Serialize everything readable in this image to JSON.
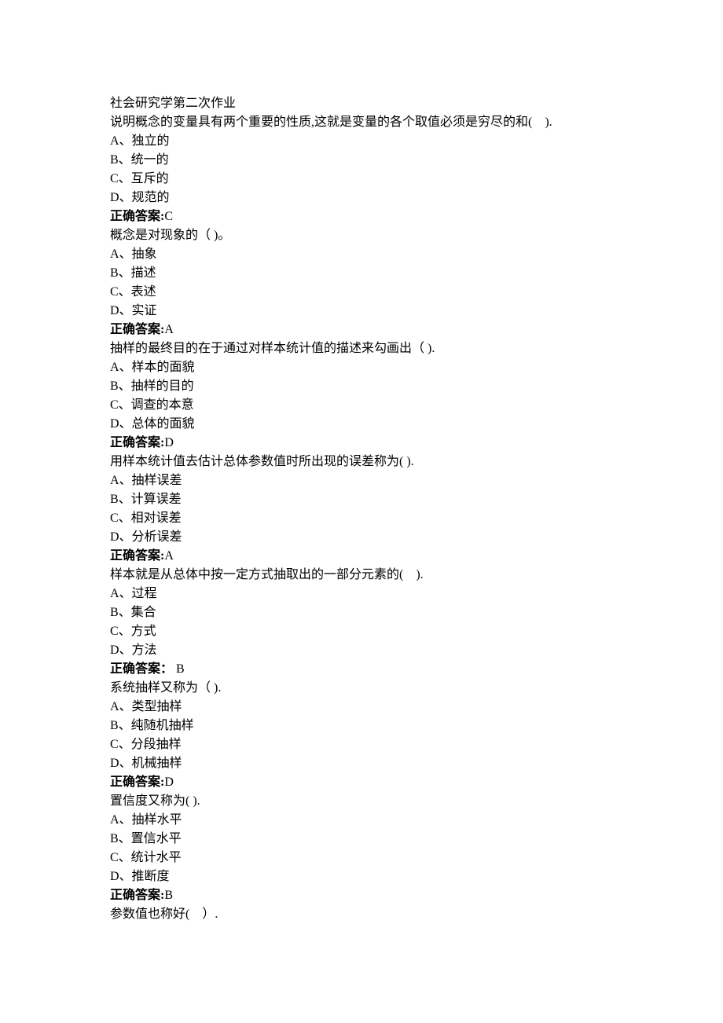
{
  "title": "社会研究学第二次作业",
  "answer_label": "正确答案",
  "answer_label_alt": "正确答案：",
  "questions": [
    {
      "stem": "说明概念的变量具有两个重要的性质,这就是变量的各个取值必须是穷尽的和(　).",
      "options": [
        "A、独立的",
        "B、统一的",
        "C、互斥的",
        "D、规范的"
      ],
      "answer": "C",
      "sep": ":"
    },
    {
      "stem": "概念是对现象的（ )。",
      "options": [
        "A、抽象",
        "B、描述",
        "C、表述",
        "D、实证"
      ],
      "answer": "A",
      "sep": ":"
    },
    {
      "stem": "抽样的最终目的在于通过对样本统计值的描述来勾画出（ ).",
      "options": [
        "A、样本的面貌",
        "B、抽样的目的",
        "C、调查的本意",
        "D、总体的面貌"
      ],
      "answer": "D",
      "sep": ":"
    },
    {
      "stem": "用样本统计值去估计总体参数值时所出现的误差称为( ).",
      "options": [
        "A、抽样误差",
        "B、计算误差",
        "C、相对误差",
        "D、分析误差"
      ],
      "answer": "A",
      "sep": ":"
    },
    {
      "stem": "样本就是从总体中按一定方式抽取出的一部分元素的(　).",
      "options": [
        "A、过程",
        "B、集合",
        "C、方式",
        "D、方法"
      ],
      "answer": "B",
      "sep": "："
    },
    {
      "stem": "系统抽样又称为（ ).",
      "options": [
        "A、类型抽样",
        "B、纯随机抽样",
        "C、分段抽样",
        "D、机械抽样"
      ],
      "answer": "D",
      "sep": ":"
    },
    {
      "stem": "置信度又称为( ).",
      "options": [
        "A、抽样水平",
        "B、置信水平",
        "C、统计水平",
        "D、推断度"
      ],
      "answer": "B",
      "sep": ":"
    },
    {
      "stem": "参数值也称好(　）.",
      "options": [],
      "answer": null,
      "sep": ""
    }
  ]
}
